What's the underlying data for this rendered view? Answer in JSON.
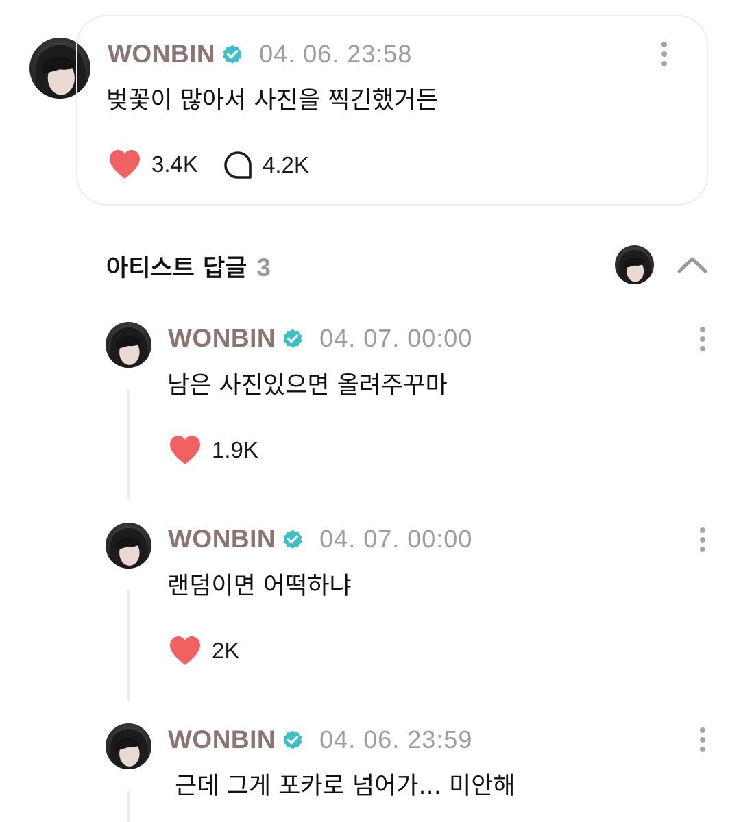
{
  "post": {
    "author": "WONBIN",
    "timestamp": "04. 06. 23:58",
    "text": "벚꽃이 많아서 사진을 찍긴했거든",
    "likes": "3.4K",
    "comments": "4.2K"
  },
  "replies_section": {
    "title": "아티스트 답글",
    "count": "3"
  },
  "replies": [
    {
      "author": "WONBIN",
      "timestamp": "04. 07. 00:00",
      "text": "남은 사진있으면 올려주꾸마",
      "likes": "1.9K"
    },
    {
      "author": "WONBIN",
      "timestamp": "04. 07. 00:00",
      "text": "랜덤이면 어떡하냐",
      "likes": "2K"
    },
    {
      "author": "WONBIN",
      "timestamp": "04. 06. 23:59",
      "text": " 근데 그게 포카로 넘어가... 미안해"
    }
  ],
  "icons": {
    "verified": "verified-badge-icon",
    "more": "more-vertical-icon",
    "like": "heart-icon",
    "comment": "comment-bubble-icon",
    "collapse": "chevron-up-icon"
  },
  "colors": {
    "author": "#8a7572",
    "verified": "#3cc0c8",
    "heart": "#f26161",
    "timestamp": "#9d9d9d",
    "card_border": "#ededed"
  }
}
